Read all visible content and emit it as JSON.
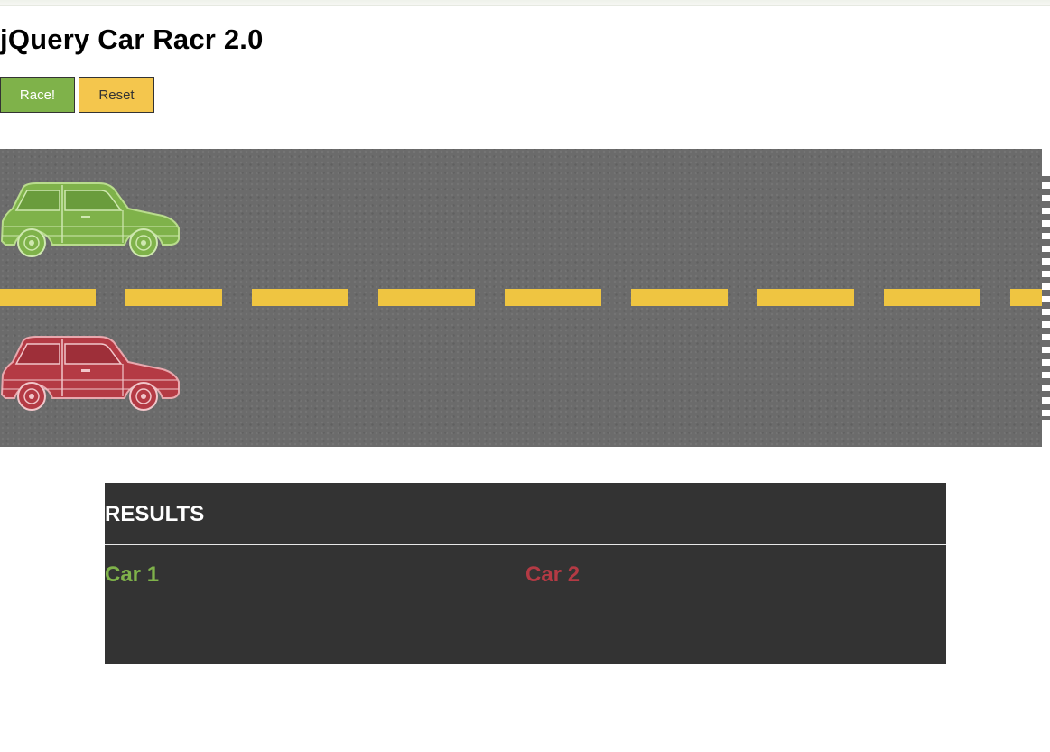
{
  "page": {
    "title": "jQuery Car Racr 2.0"
  },
  "controls": {
    "race_label": "Race!",
    "reset_label": "Reset"
  },
  "track": {
    "cars": [
      {
        "id": "car-1",
        "color": "#7fb24a"
      },
      {
        "id": "car-2",
        "color": "#b43a44"
      }
    ],
    "lane_marking_color": "#efc541",
    "finish_line": "checkered"
  },
  "results": {
    "heading": "RESULTS",
    "columns": [
      {
        "label": "Car 1",
        "color": "#7fb24a"
      },
      {
        "label": "Car 2",
        "color": "#b43a44"
      }
    ]
  },
  "colors": {
    "race_button": "#7fb24a",
    "reset_button": "#f4c64d",
    "track": "#6b6b6b",
    "results_panel": "#333333"
  }
}
